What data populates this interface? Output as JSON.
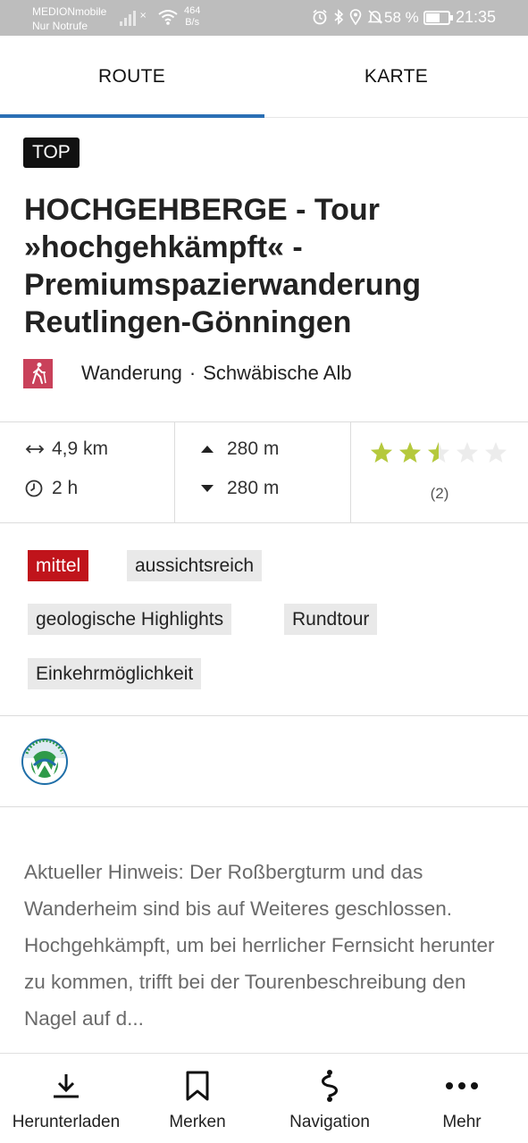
{
  "status_bar": {
    "carrier_line1": "MEDIONmobile",
    "carrier_line2": "Nur Notrufe",
    "speed_value": "464",
    "speed_unit": "B/s",
    "battery_percent": "58 %",
    "battery_level": 0.58,
    "time": "21:35"
  },
  "tabs": [
    {
      "label": "ROUTE",
      "active": true
    },
    {
      "label": "KARTE",
      "active": false
    }
  ],
  "badge": "TOP",
  "title": "HOCHGEHBERGE - Tour\n»hochgehkämpft« -\nPremiumspazierwanderung\nReutlingen-Gönningen",
  "category": {
    "type": "Wanderung",
    "separator": "·",
    "region": "Schwäbische Alb",
    "icon": "hiker-icon",
    "icon_color": "#c9415a"
  },
  "stats": {
    "distance": "4,9 km",
    "duration": "2 h",
    "ascent": "280 m",
    "descent": "280 m",
    "rating": 2.5,
    "rating_max": 5,
    "rating_count": "(2)",
    "star_color": "#b5c93c"
  },
  "tags": [
    {
      "label": "mittel",
      "kind": "difficulty",
      "color": "#c0141b"
    },
    {
      "label": "aussichtsreich"
    },
    {
      "label": "geologische Highlights"
    },
    {
      "label": "Rundtour"
    },
    {
      "label": "Einkehrmöglichkeit"
    }
  ],
  "description": "Aktueller Hinweis: Der Roßbergturm und das Wanderheim sind bis auf Weiteres geschlossen.  Hochgehkämpft, um bei herrlicher Fernsicht herunter zu kommen, trifft bei der Tourenbeschreibung den Nagel auf d...",
  "bottom_nav": [
    {
      "label": "Herunterladen",
      "icon": "download-icon"
    },
    {
      "label": "Merken",
      "icon": "bookmark-icon"
    },
    {
      "label": "Navigation",
      "icon": "route-icon"
    },
    {
      "label": "Mehr",
      "icon": "more-icon"
    }
  ],
  "colors": {
    "accent": "#2a6fb5"
  }
}
